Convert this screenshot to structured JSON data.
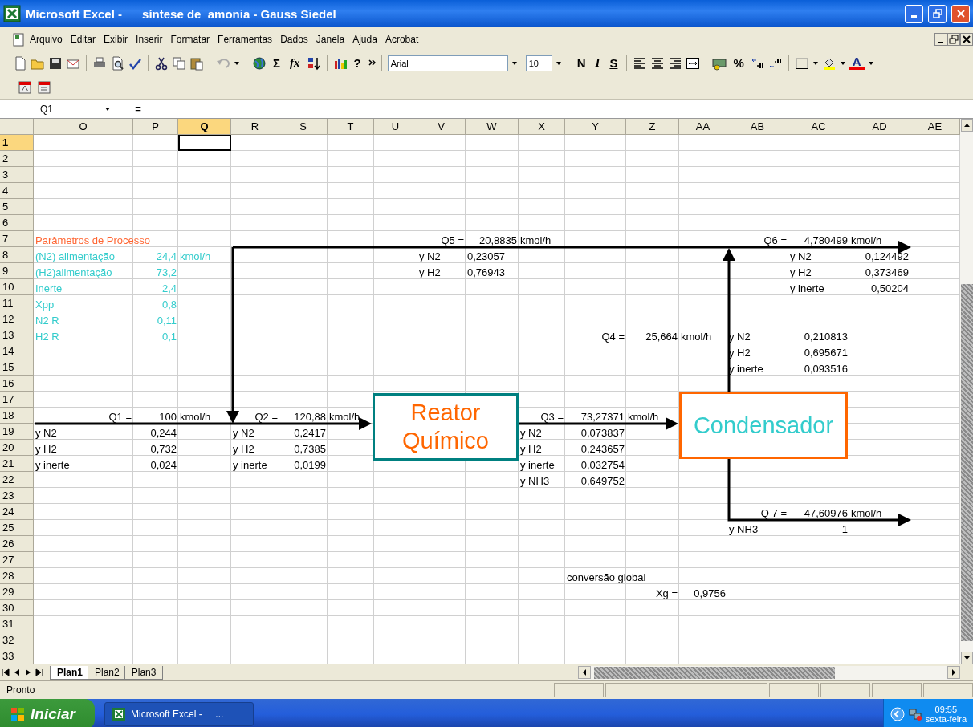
{
  "window": {
    "title": "Microsoft Excel -      síntese de  amonia - Gauss Siedel"
  },
  "menu": [
    "Arquivo",
    "Editar",
    "Exibir",
    "Inserir",
    "Formatar",
    "Ferramentas",
    "Dados",
    "Janela",
    "Ajuda",
    "Acrobat"
  ],
  "toolbar": {
    "sum": "Σ",
    "function": "fx",
    "help": "?",
    "font": "Arial",
    "size": "10",
    "bold": "N",
    "italic": "I",
    "underline": "S",
    "percent": "%",
    "font_color": "A"
  },
  "formula_bar": {
    "name_box": "Q1",
    "equals": "="
  },
  "columns": [
    "O",
    "P",
    "Q",
    "R",
    "S",
    "T",
    "U",
    "V",
    "W",
    "X",
    "Y",
    "Z",
    "AA",
    "AB",
    "AC",
    "AD",
    "AE"
  ],
  "rows": [
    {
      "label": "1",
      "cells": {
        "Q": {
          "selected": true
        }
      }
    },
    {
      "label": "2"
    },
    {
      "label": "3"
    },
    {
      "label": "4"
    },
    {
      "label": "5"
    },
    {
      "label": "6"
    },
    {
      "label": "7",
      "cells": {
        "O": {
          "text": "Parâmetros de  Processo",
          "kind": "heading"
        },
        "V": {
          "text": "Q5 =",
          "kind": "label"
        },
        "W": {
          "text": "20,8835",
          "kind": "value"
        },
        "X": {
          "text": "kmol/h",
          "kind": "text"
        },
        "AB": {
          "text": "Q6 =",
          "kind": "label"
        },
        "AC": {
          "text": "4,780499",
          "kind": "value"
        },
        "AD": {
          "text": "kmol/h",
          "kind": "text"
        }
      }
    },
    {
      "label": "8",
      "cells": {
        "O": {
          "text": "(N2) alimentação",
          "kind": "param"
        },
        "P": {
          "text": "24,4",
          "kind": "param_value"
        },
        "Q": {
          "text": "kmol/h",
          "kind": "param"
        },
        "V": {
          "text": "y N2",
          "kind": "text"
        },
        "W": {
          "text": "0,23057",
          "kind": "text"
        },
        "AC": {
          "text": "y N2",
          "kind": "text"
        },
        "AD": {
          "text": "0,124492",
          "kind": "value"
        }
      }
    },
    {
      "label": "9",
      "cells": {
        "O": {
          "text": "(H2)alimentação",
          "kind": "param"
        },
        "P": {
          "text": "73,2",
          "kind": "param_value"
        },
        "V": {
          "text": "y H2",
          "kind": "text"
        },
        "W": {
          "text": "0,76943",
          "kind": "text"
        },
        "AC": {
          "text": "y H2",
          "kind": "text"
        },
        "AD": {
          "text": "0,373469",
          "kind": "value"
        }
      }
    },
    {
      "label": "10",
      "cells": {
        "O": {
          "text": "Inerte",
          "kind": "param"
        },
        "P": {
          "text": "2,4",
          "kind": "param_value"
        },
        "AC": {
          "text": "y inerte",
          "kind": "text"
        },
        "AD": {
          "text": "0,50204",
          "kind": "value"
        }
      }
    },
    {
      "label": "11",
      "cells": {
        "O": {
          "text": "Xpp",
          "kind": "param"
        },
        "P": {
          "text": "0,8",
          "kind": "param_value"
        }
      }
    },
    {
      "label": "12",
      "cells": {
        "O": {
          "text": "N2  R",
          "kind": "param"
        },
        "P": {
          "text": "0,11",
          "kind": "param_value"
        }
      }
    },
    {
      "label": "13",
      "cells": {
        "O": {
          "text": "H2 R",
          "kind": "param"
        },
        "P": {
          "text": "0,1",
          "kind": "param_value"
        },
        "Y": {
          "text": "Q4 =",
          "kind": "label"
        },
        "Z": {
          "text": "25,664",
          "kind": "value"
        },
        "AA": {
          "text": "kmol/h",
          "kind": "text"
        },
        "AB": {
          "text": "y N2",
          "kind": "text"
        },
        "AC": {
          "text": "0,210813",
          "kind": "value"
        }
      }
    },
    {
      "label": "14",
      "cells": {
        "AB": {
          "text": "y H2",
          "kind": "text"
        },
        "AC": {
          "text": "0,695671",
          "kind": "value"
        }
      }
    },
    {
      "label": "15",
      "cells": {
        "AB": {
          "text": "y inerte",
          "kind": "text"
        },
        "AC": {
          "text": "0,093516",
          "kind": "value"
        }
      }
    },
    {
      "label": "16"
    },
    {
      "label": "17"
    },
    {
      "label": "18",
      "cells": {
        "O": {
          "text": "Q1 =",
          "kind": "label"
        },
        "P": {
          "text": "100",
          "kind": "value"
        },
        "Q": {
          "text": "kmol/h",
          "kind": "text"
        },
        "R": {
          "text": "Q2 =",
          "kind": "label"
        },
        "S": {
          "text": "120,88",
          "kind": "value"
        },
        "T": {
          "text": "kmol/h",
          "kind": "text"
        },
        "X": {
          "text": "Q3 =",
          "kind": "label"
        },
        "Y": {
          "text": "73,27371",
          "kind": "value"
        },
        "Z": {
          "text": "kmol/h",
          "kind": "text"
        }
      }
    },
    {
      "label": "19",
      "cells": {
        "O": {
          "text": "y N2",
          "kind": "text"
        },
        "P": {
          "text": "0,244",
          "kind": "value"
        },
        "R": {
          "text": "y N2",
          "kind": "text"
        },
        "S": {
          "text": "0,2417",
          "kind": "value"
        },
        "X": {
          "text": "y N2",
          "kind": "text"
        },
        "Y": {
          "text": "0,073837",
          "kind": "value"
        }
      }
    },
    {
      "label": "20",
      "cells": {
        "O": {
          "text": "y H2",
          "kind": "text"
        },
        "P": {
          "text": "0,732",
          "kind": "value"
        },
        "R": {
          "text": "y H2",
          "kind": "text"
        },
        "S": {
          "text": "0,7385",
          "kind": "value"
        },
        "X": {
          "text": "y H2",
          "kind": "text"
        },
        "Y": {
          "text": "0,243657",
          "kind": "value"
        }
      }
    },
    {
      "label": "21",
      "cells": {
        "O": {
          "text": "y inerte",
          "kind": "text"
        },
        "P": {
          "text": "0,024",
          "kind": "value"
        },
        "R": {
          "text": "y inerte",
          "kind": "text"
        },
        "S": {
          "text": "0,0199",
          "kind": "value"
        },
        "X": {
          "text": "y inerte",
          "kind": "text"
        },
        "Y": {
          "text": "0,032754",
          "kind": "value"
        }
      }
    },
    {
      "label": "22",
      "cells": {
        "X": {
          "text": "y NH3",
          "kind": "text"
        },
        "Y": {
          "text": "0,649752",
          "kind": "value"
        }
      }
    },
    {
      "label": "23"
    },
    {
      "label": "24",
      "cells": {
        "AB": {
          "text": "Q 7 =",
          "kind": "label"
        },
        "AC": {
          "text": "47,60976",
          "kind": "value"
        },
        "AD": {
          "text": "kmol/h",
          "kind": "text"
        }
      }
    },
    {
      "label": "25",
      "cells": {
        "AB": {
          "text": "y NH3",
          "kind": "text"
        },
        "AC": {
          "text": "1",
          "kind": "value"
        }
      }
    },
    {
      "label": "26"
    },
    {
      "label": "27"
    },
    {
      "label": "28",
      "cells": {
        "Y": {
          "text": "conversão global",
          "kind": "text"
        }
      }
    },
    {
      "label": "29",
      "cells": {
        "Z": {
          "text": "Xg =",
          "kind": "label"
        },
        "AA": {
          "text": "0,9756",
          "kind": "value"
        }
      }
    },
    {
      "label": "30"
    },
    {
      "label": "31"
    },
    {
      "label": "32"
    },
    {
      "label": "33"
    }
  ],
  "diagram": {
    "nodes": [
      {
        "kind": "reactor",
        "label": "Reator Químico"
      },
      {
        "kind": "condenser",
        "label": "Condensador"
      }
    ]
  },
  "sheet_tabs": [
    {
      "label": "Plan1",
      "selected": true
    },
    {
      "label": "Plan2",
      "selected": false
    },
    {
      "label": "Plan3",
      "selected": false
    }
  ],
  "status_bar": "Pronto",
  "taskbar": {
    "start": "Iniciar",
    "task": "Microsoft Excel -     ...",
    "time": "09:55",
    "day": "sexta-feira"
  }
}
